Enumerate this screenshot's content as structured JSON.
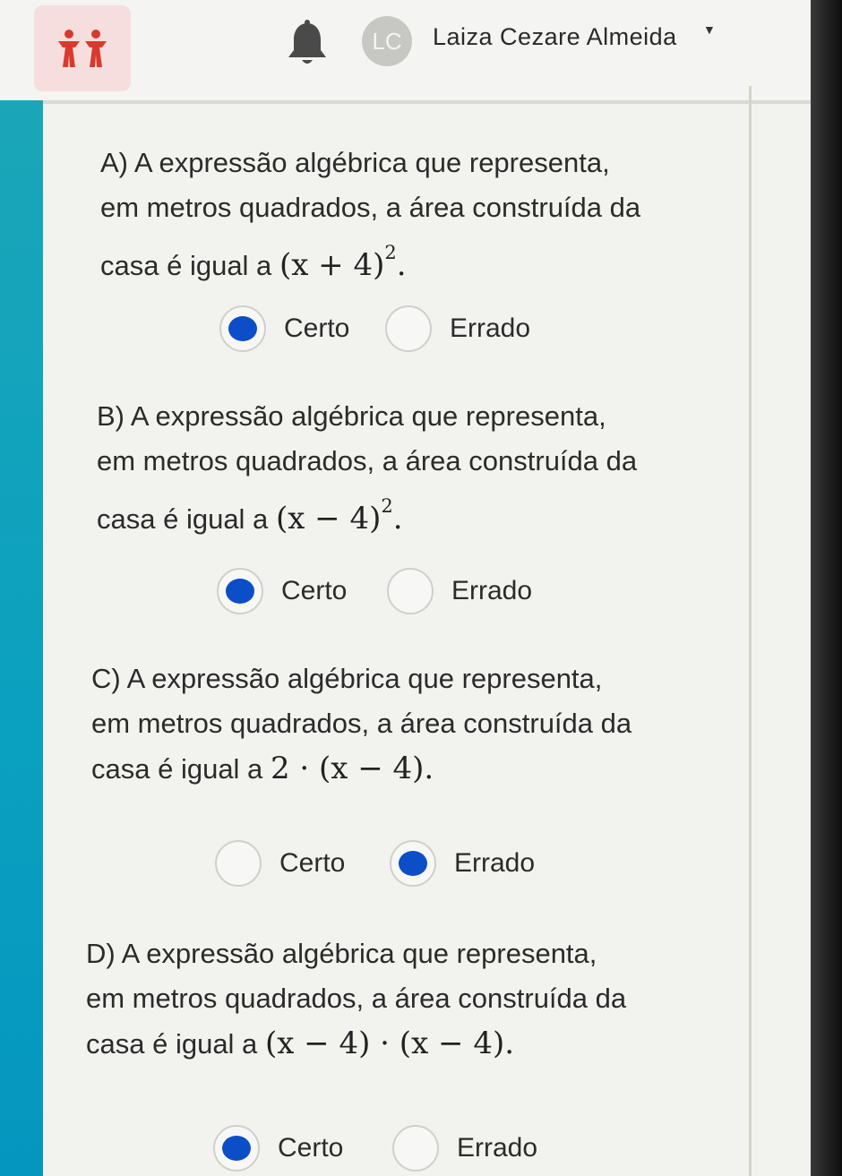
{
  "header": {
    "avatar_initials": "LC",
    "user_name": "Laiza Cezare Almeida",
    "logo_color": "#d93a2e",
    "logo_bg": "#f6dede"
  },
  "theme": {
    "accent": "#0b4ec8",
    "stripe": "#0aa0c0"
  },
  "questions": [
    {
      "label": "A) A expressão algébrica que representa,",
      "line2": "em metros quadrados, a área construída da",
      "line3_prefix": "casa é igual a",
      "expression": "(x + 4)",
      "exponent": "2",
      "suffix": ".",
      "option_certo": "Certo",
      "option_errado": "Errado",
      "selected": "Certo"
    },
    {
      "label": "B) A expressão algébrica que representa,",
      "line2": "em metros quadrados, a área construída da",
      "line3_prefix": "casa é igual a",
      "expression": "(x − 4)",
      "exponent": "2",
      "suffix": ".",
      "option_certo": "Certo",
      "option_errado": "Errado",
      "selected": "Certo"
    },
    {
      "label": "C) A expressão algébrica que representa,",
      "line2": "em metros quadrados, a área construída da",
      "line3_prefix": "casa é igual a",
      "expression": "2 · (x − 4).",
      "exponent": "",
      "suffix": "",
      "option_certo": "Certo",
      "option_errado": "Errado",
      "selected": "Errado"
    },
    {
      "label": "D) A expressão algébrica que representa,",
      "line2": "em metros quadrados, a área construída da",
      "line3_prefix": "casa é igual a",
      "expression": "(x − 4) · (x − 4).",
      "exponent": "",
      "suffix": "",
      "option_certo": "Certo",
      "option_errado": "Errado",
      "selected": "Certo"
    }
  ]
}
